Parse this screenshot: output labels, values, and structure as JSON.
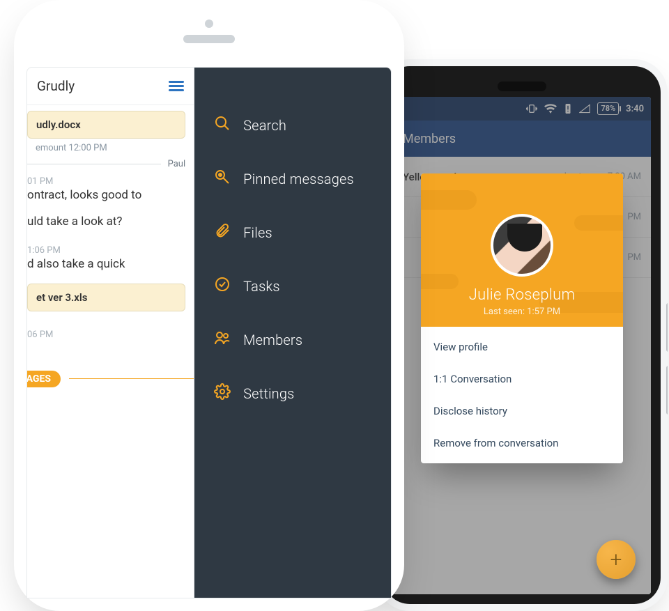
{
  "iphone": {
    "header_title": "Grudly",
    "file1": "udly.docx",
    "meta1": "emount 12:00 PM",
    "divider_name": "Paul",
    "ts1": "01 PM",
    "msg1": "ontract, looks good to",
    "msg2": "uld take a look at?",
    "ts2": "1:06 PM",
    "msg3": "d also take a quick",
    "file2": "et ver 3.xls",
    "ts3": "06 PM",
    "badge": "SAGES"
  },
  "drawer": {
    "items": [
      {
        "label": "Search",
        "icon": "search-icon"
      },
      {
        "label": "Pinned messages",
        "icon": "pin-icon"
      },
      {
        "label": "Files",
        "icon": "paperclip-icon"
      },
      {
        "label": "Tasks",
        "icon": "check-circle-icon"
      },
      {
        "label": "Members",
        "icon": "members-icon"
      },
      {
        "label": "Settings",
        "icon": "gear-icon"
      }
    ]
  },
  "android": {
    "status": {
      "battery": "78%",
      "time": "3:40"
    },
    "appbar_title": "Members",
    "list": [
      {
        "name": "Yellowspark",
        "last": "Last seen: 7:30 AM"
      },
      {
        "name": "",
        "last": "PM"
      },
      {
        "name": "",
        "last": "PM"
      }
    ],
    "profile": {
      "name": "Julie Roseplum",
      "last_seen": "Last seen: 1:57 PM",
      "actions": {
        "view": "View profile",
        "one_one": "1:1 Conversation",
        "disclose": "Disclose history",
        "remove": "Remove from conversation"
      }
    }
  }
}
